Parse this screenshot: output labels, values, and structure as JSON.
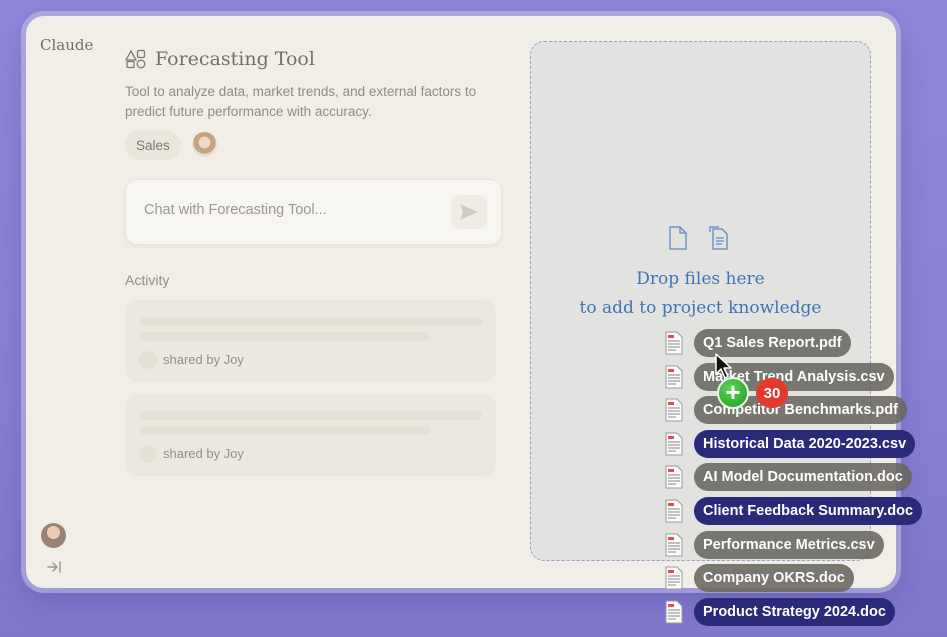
{
  "app": {
    "brand": "Claude"
  },
  "project": {
    "title": "Forecasting Tool",
    "description": "Tool to analyze data, market trends, and external factors to predict future performance with accuracy.",
    "tag": "Sales"
  },
  "chat": {
    "placeholder": "Chat with Forecasting Tool..."
  },
  "activity": {
    "label": "Activity",
    "items": [
      {
        "shared_by": "shared by Joy"
      },
      {
        "shared_by": "shared by Joy"
      }
    ]
  },
  "dropzone": {
    "line1": "Drop files here",
    "line2": "to add to project knowledge"
  },
  "drag": {
    "count": "30",
    "files": [
      {
        "name": "Q1 Sales Report.pdf",
        "style": "grey"
      },
      {
        "name": "Market Trend Analysis.csv",
        "style": "grey"
      },
      {
        "name": "Competitor Benchmarks.pdf",
        "style": "grey"
      },
      {
        "name": "Historical Data 2020-2023.csv",
        "style": "navy"
      },
      {
        "name": "AI Model Documentation.doc",
        "style": "grey"
      },
      {
        "name": "Client Feedback Summary.doc",
        "style": "navy"
      },
      {
        "name": "Performance Metrics.csv",
        "style": "grey"
      },
      {
        "name": "Company OKRS.doc",
        "style": "grey"
      },
      {
        "name": "Product Strategy 2024.doc",
        "style": "navy"
      }
    ]
  },
  "icons": {
    "shapes": "shapes-icon",
    "send": "send-arrow-icon",
    "collapse": "collapse-sidebar-icon",
    "file": "document-icon",
    "cursor": "mouse-pointer-icon",
    "plus": "plus-icon"
  },
  "colors": {
    "dropzone_text": "#3f74b8",
    "badge": "#e23b2e",
    "plus": "#1d9a1d",
    "navy_pill": "#2a2a78"
  }
}
